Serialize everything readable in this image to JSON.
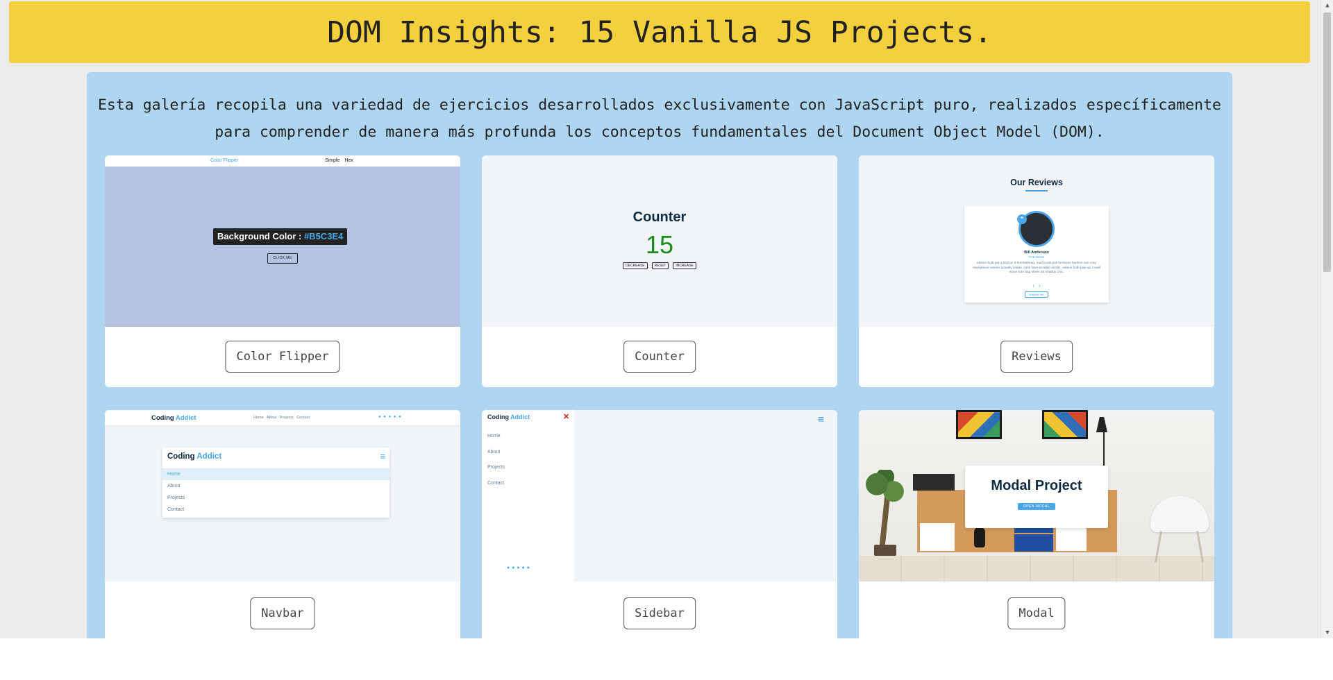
{
  "header": {
    "title": "DOM Insights: 15 Vanilla JS Projects."
  },
  "intro": {
    "line1": "Esta galería recopila una variedad de ejercicios desarrollados exclusivamente con JavaScript puro, realizados específicamente",
    "line2": "para comprender de manera más profunda los conceptos fundamentales del Document Object Model (DOM)."
  },
  "projects": [
    {
      "button": "Color Flipper",
      "preview": {
        "nav_logo": "Color Flipper",
        "nav_links": "Simple Hex",
        "label_prefix": "Background Color : ",
        "hex": "#B5C3E4",
        "click_button": "CLICK ME"
      }
    },
    {
      "button": "Counter",
      "preview": {
        "title": "Counter",
        "value": "15",
        "buttons": [
          "DECREASE",
          "RESET",
          "INCREASE"
        ]
      }
    },
    {
      "button": "Reviews",
      "preview": {
        "title": "Our Reviews",
        "name": "Bill Anderson",
        "job": "THE BOSS",
        "text": "edison bulb put a bird on it humblebrag, marfa pok pok heirloom fashion axe cray stumptown venmo actually seitan. VHS farm-to-table schlitz, edison bulb pop-up 3 wolf moon tote bag street art shabby chic.",
        "arrows": "‹ ›",
        "surprise": "surprise me"
      }
    },
    {
      "button": "Navbar",
      "preview": {
        "logo_main": "Coding ",
        "logo_accent": "Addict",
        "links": "Home About Projects Contact",
        "social": "● ● ● ● ●",
        "menu_items": [
          "Home",
          "About",
          "Projects",
          "Contact"
        ],
        "burger": "≡"
      }
    },
    {
      "button": "Sidebar",
      "preview": {
        "logo_main": "Coding ",
        "logo_accent": "Addict",
        "close": "✕",
        "items": [
          "Home",
          "About",
          "Projects",
          "Contact"
        ],
        "social": "● ● ● ● ●",
        "toggle": "≡"
      }
    },
    {
      "button": "Modal",
      "preview": {
        "title": "Modal Project",
        "open_button": "OPEN MODAL"
      }
    }
  ],
  "colors": {
    "header_bg": "#f4d03f",
    "gallery_bg": "#aed6f1",
    "accent": "#49a6e9",
    "counter_value": "#1a8c1a",
    "flipper_bg": "#b5c3e4"
  }
}
